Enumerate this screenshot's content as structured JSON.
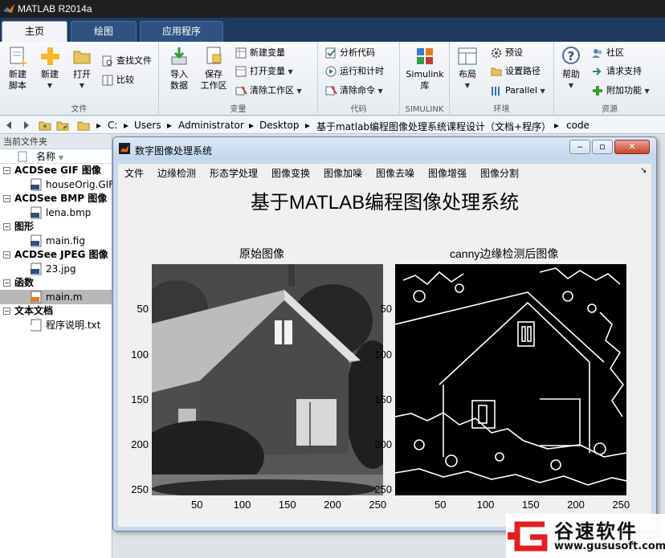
{
  "app": {
    "title": "MATLAB R2014a"
  },
  "tabs": [
    {
      "label": "主页"
    },
    {
      "label": "绘图"
    },
    {
      "label": "应用程序"
    }
  ],
  "ribbon": {
    "file": {
      "group_label": "文件",
      "new_script": "新建\n脚本",
      "new": "新建",
      "open": "打开",
      "find_files": "查找文件",
      "compare": "比较"
    },
    "variable": {
      "group_label": "变量",
      "import_data": "导入\n数据",
      "save_workspace": "保存\n工作区",
      "new_variable": "新建变量",
      "open_variable": "打开变量",
      "clear_workspace": "清除工作区"
    },
    "code": {
      "group_label": "代码",
      "analyze_code": "分析代码",
      "run_and_time": "运行和计时",
      "clear_commands": "清除命令"
    },
    "simulink": {
      "group_label": "SIMULINK",
      "simulink_library": "Simulink\n库"
    },
    "environment": {
      "group_label": "环境",
      "layout": "布局",
      "preferences": "预设",
      "set_path": "设置路径",
      "parallel": "Parallel"
    },
    "resources": {
      "group_label": "资源",
      "help": "帮助",
      "community": "社区",
      "request_support": "请求支持",
      "addons": "附加功能"
    }
  },
  "address": {
    "crumbs": [
      "C:",
      "Users",
      "Administrator",
      "Desktop",
      "基于matlab编程图像处理系统课程设计（文档+程序）",
      "code"
    ]
  },
  "folder_panel": {
    "title": "当前文件夹",
    "column_header": "名称",
    "groups": [
      {
        "label": "ACDSee GIF 图像",
        "items": [
          {
            "name": "houseOrig.GIF",
            "icon": "gif-file-icon"
          }
        ]
      },
      {
        "label": "ACDSee BMP 图像",
        "items": [
          {
            "name": "lena.bmp",
            "icon": "bmp-file-icon"
          }
        ]
      },
      {
        "label": "图形",
        "items": [
          {
            "name": "main.fig",
            "icon": "fig-file-icon"
          }
        ]
      },
      {
        "label": "ACDSee JPEG 图像",
        "items": [
          {
            "name": "23.jpg",
            "icon": "jpeg-file-icon"
          }
        ]
      },
      {
        "label": "函数",
        "items": [
          {
            "name": "main.m",
            "icon": "m-file-icon",
            "selected": true
          }
        ]
      },
      {
        "label": "文本文档",
        "items": [
          {
            "name": "程序说明.txt",
            "icon": "txt-file-icon"
          }
        ]
      }
    ]
  },
  "figure": {
    "window_title": "数字图像处理系统",
    "menu": [
      "文件",
      "边缘检测",
      "形态学处理",
      "图像变换",
      "图像加噪",
      "图像去噪",
      "图像增强",
      "图像分割"
    ],
    "main_title": "基于MATLAB编程图像处理系统",
    "left_axes_title": "原始图像",
    "right_axes_title": "canny边缘检测后图像",
    "y_ticks": [
      "50",
      "100",
      "150",
      "200",
      "250"
    ],
    "x_ticks": [
      "50",
      "100",
      "150",
      "200",
      "250"
    ],
    "image_size": 256
  },
  "watermark": {
    "title": "谷速软件",
    "url": "www.gususoft.com"
  },
  "colors": {
    "accent": "#1e3a5f",
    "tab_active": "#f1f3f6",
    "selection": "#b8b8b8"
  }
}
